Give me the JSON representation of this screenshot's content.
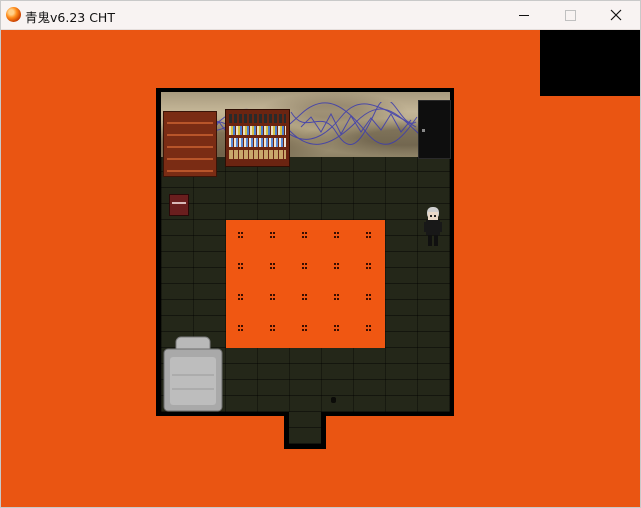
{
  "window": {
    "title": "青鬼v6.23  CHT",
    "buttons": {
      "minimize_icon": "minimize-icon",
      "maximize_icon": "maximize-icon",
      "close_icon": "close-icon"
    }
  },
  "scene": {
    "background_color": "#ea5512",
    "panel_color": "#f05712",
    "floor_color": "#242719",
    "grid_rows": 4,
    "grid_cols": 5,
    "objects": [
      "bookshelf",
      "bookshelf",
      "door",
      "small-box",
      "character",
      "sofa",
      "dot-grid-panel"
    ]
  }
}
